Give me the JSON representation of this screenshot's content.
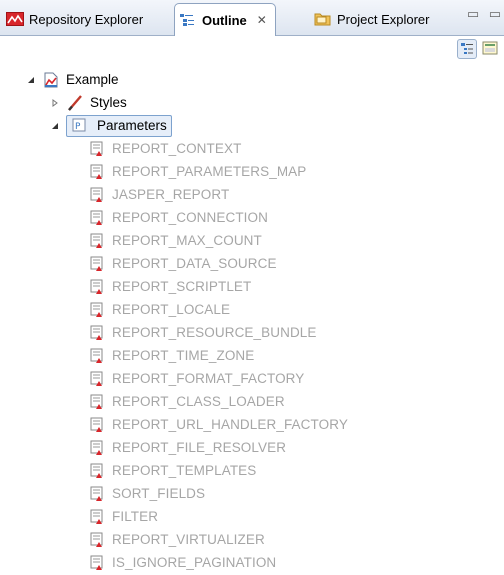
{
  "tabs": [
    {
      "label": "Repository Explorer",
      "icon": "repository-icon",
      "active": false
    },
    {
      "label": "Outline",
      "icon": "outline-icon",
      "active": true,
      "close": "✕"
    },
    {
      "label": "Project Explorer",
      "icon": "project-explorer-icon",
      "active": false
    }
  ],
  "window_controls": "▭ ▭",
  "colors": {
    "accent": "#7da2ce",
    "disabled_text": "#a6a6a6",
    "tab_bg": "#dde5f0"
  },
  "tree": {
    "root": {
      "label": "Example",
      "icon": "report-icon",
      "expanded": true
    },
    "styles": {
      "label": "Styles",
      "icon": "styles-icon",
      "expanded": false
    },
    "parameters": {
      "label": "Parameters",
      "icon": "parameters-icon",
      "expanded": true,
      "selected": true
    },
    "parameter_items": [
      "REPORT_CONTEXT",
      "REPORT_PARAMETERS_MAP",
      "JASPER_REPORT",
      "REPORT_CONNECTION",
      "REPORT_MAX_COUNT",
      "REPORT_DATA_SOURCE",
      "REPORT_SCRIPTLET",
      "REPORT_LOCALE",
      "REPORT_RESOURCE_BUNDLE",
      "REPORT_TIME_ZONE",
      "REPORT_FORMAT_FACTORY",
      "REPORT_CLASS_LOADER",
      "REPORT_URL_HANDLER_FACTORY",
      "REPORT_FILE_RESOLVER",
      "REPORT_TEMPLATES",
      "SORT_FIELDS",
      "FILTER",
      "REPORT_VIRTUALIZER",
      "IS_IGNORE_PAGINATION"
    ]
  }
}
